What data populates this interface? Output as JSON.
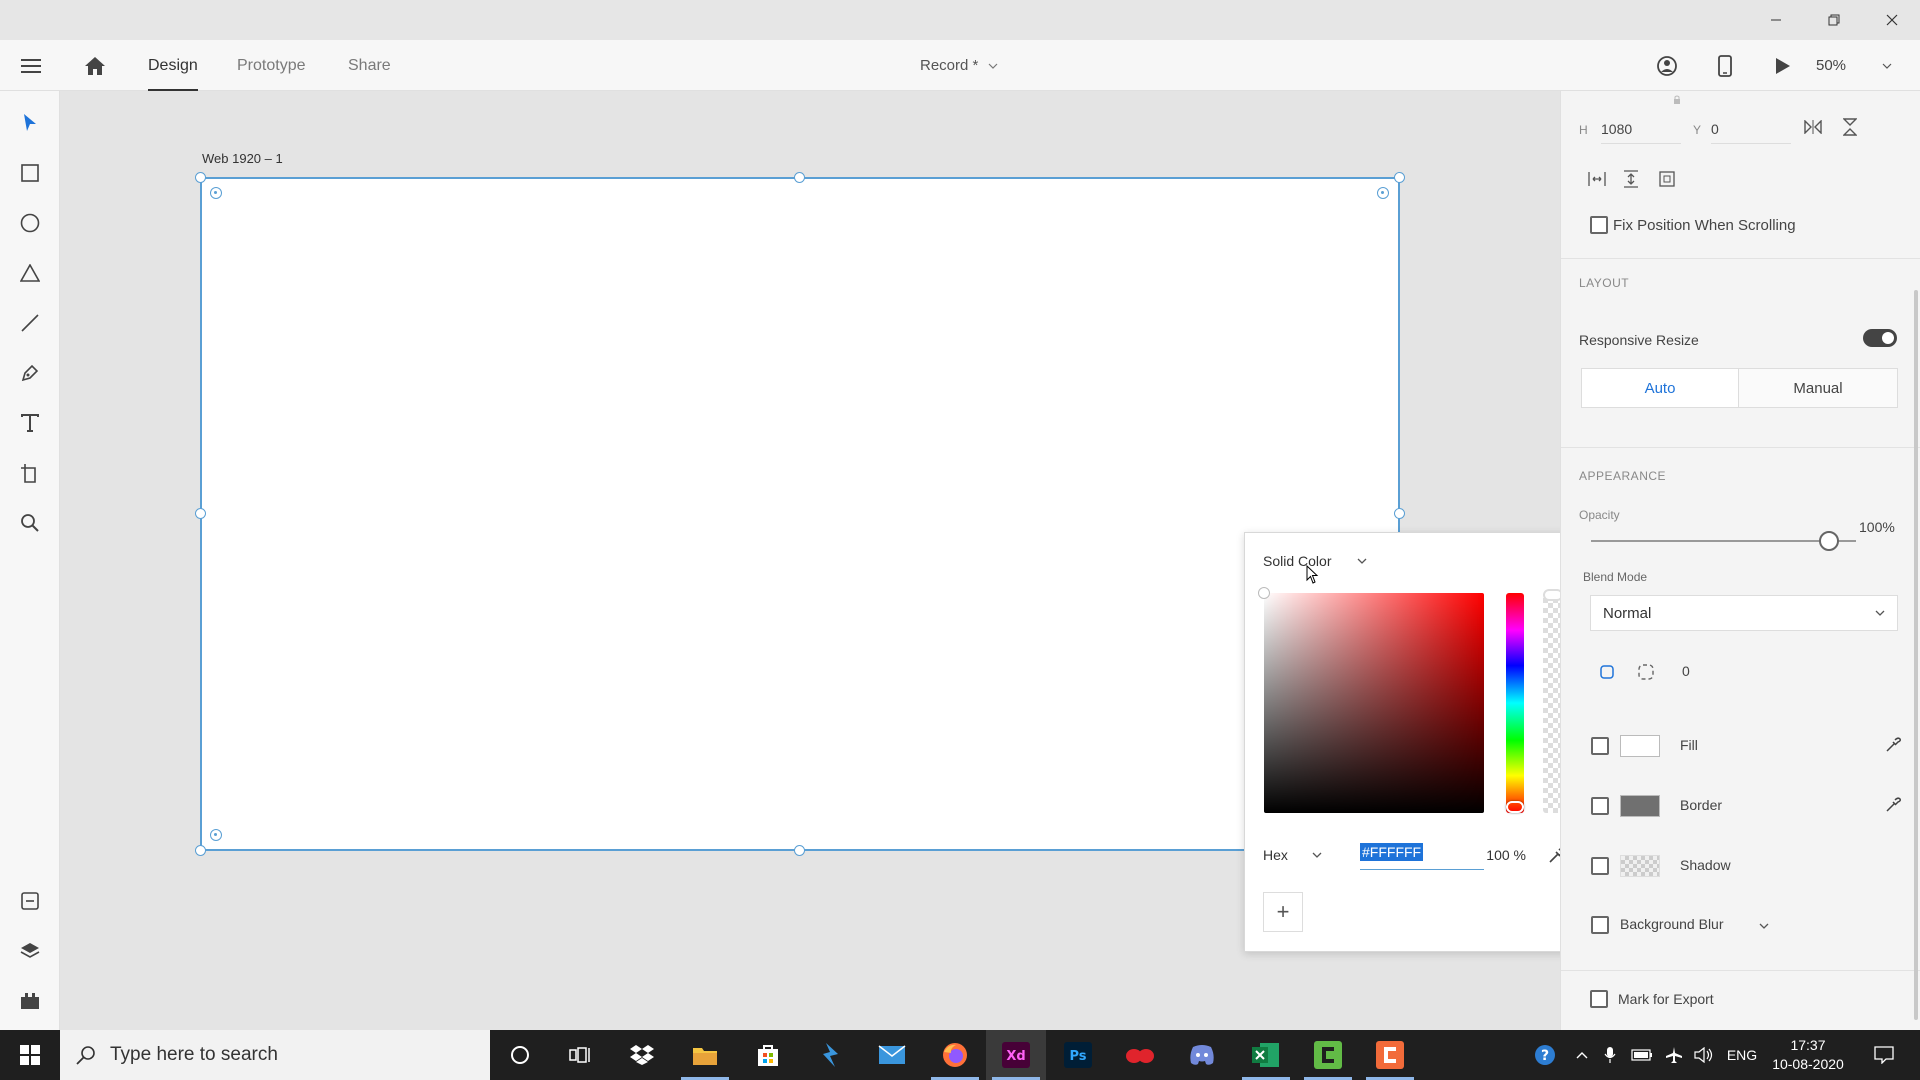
{
  "header": {
    "tabs": [
      {
        "label": "Design",
        "active": true
      },
      {
        "label": "Prototype",
        "active": false
      },
      {
        "label": "Share",
        "active": false
      }
    ],
    "document_title": "Record *",
    "zoom": "50%"
  },
  "canvas": {
    "artboard_label": "Web 1920 – 1"
  },
  "color_picker": {
    "type": "Solid Color",
    "mode": "Hex",
    "hex_value": "#FFFFFF",
    "opacity": "100 %",
    "add_label": "+"
  },
  "right_panel": {
    "h_label": "H",
    "h_value": "1080",
    "y_label": "Y",
    "y_value": "0",
    "fix_position": "Fix Position When Scrolling",
    "layout_head": "LAYOUT",
    "responsive_resize": "Responsive Resize",
    "resize_auto": "Auto",
    "resize_manual": "Manual",
    "appearance_head": "APPEARANCE",
    "opacity_label": "Opacity",
    "opacity_value": "100%",
    "opacity_level": 1.0,
    "blend_label": "Blend Mode",
    "blend_value": "Normal",
    "corner_value": "0",
    "fill_label": "Fill",
    "border_label": "Border",
    "shadow_label": "Shadow",
    "bg_blur_label": "Background Blur",
    "export_label": "Mark for Export"
  },
  "taskbar": {
    "search_placeholder": "Type here to search",
    "language": "ENG",
    "time": "17:37",
    "date": "10-08-2020"
  },
  "colors": {
    "accent": "#1e73d9",
    "selection": "#5a9fd4",
    "fill_swatch": "#ffffff",
    "border_swatch": "#707070"
  }
}
